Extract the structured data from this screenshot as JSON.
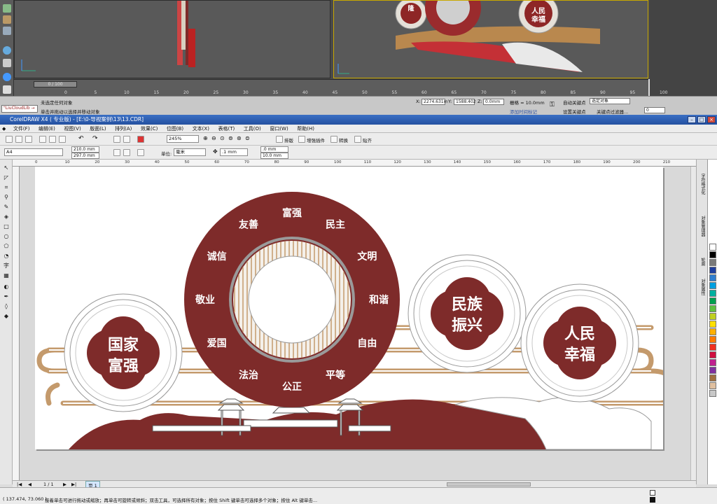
{
  "max": {
    "status_line_1": "未选定任何对象",
    "status_line_2": "单击并拖动以选择并移动对象",
    "timeline_slider": "0 / 100",
    "timeline_ticks": [
      "0",
      "5",
      "10",
      "15",
      "20",
      "25",
      "30",
      "35",
      "40",
      "45",
      "50",
      "55",
      "60",
      "65",
      "70",
      "75",
      "80",
      "85",
      "90",
      "95",
      "100"
    ],
    "coord_x_label": "X:",
    "coord_x": "2274.631m",
    "coord_y_label": "Y:",
    "coord_y": "1588.402",
    "coord_z_label": "Z:",
    "coord_z": "0.0mm",
    "grid": "栅格 = 10.0mm",
    "add_time_tag": "添加时间标记",
    "auto_key": "自动关键点",
    "set_key": "设置关键点",
    "key_filter_select": "选定对象",
    "key_filters": "关键点过滤器...",
    "frame": "0",
    "script_box": "\"LiuCloudLib →"
  },
  "corel": {
    "title": "CorelDRAW X4 ( 专业版) - [E:\\0-导视案例\\13\\13.CDR]",
    "menu": [
      "文件(F)",
      "编辑(E)",
      "视图(V)",
      "版面(L)",
      "排列(A)",
      "效果(C)",
      "位图(B)",
      "文本(X)",
      "表格(T)",
      "工具(O)",
      "窗口(W)",
      "帮助(H)"
    ],
    "toolbar": {
      "zoom": "245%",
      "typeset": "排版",
      "plugin": "增强插件",
      "convert": "转换",
      "paste": "贴齐"
    },
    "props": {
      "page_size": "A4",
      "width": "210.0 mm",
      "height": "297.0 mm",
      "unit_label": "单位:",
      "unit": "毫米",
      "nudge": ".1 mm",
      "dup_x": ".0 mm",
      "dup_y": "10.0 mm"
    },
    "ruler_ticks": [
      "0",
      "10",
      "20",
      "30",
      "40",
      "50",
      "60",
      "70",
      "80",
      "90",
      "100",
      "110",
      "120",
      "130",
      "140",
      "150",
      "160",
      "170",
      "180",
      "190",
      "200",
      "210"
    ],
    "page_nav": "1 / 1",
    "page_tab": "页 1",
    "status_coords": "( 137.474, 73.060 )",
    "status_hint": "接着单击可进行拖动或缩放；再单击可旋转或倾斜；双击工具，可选择所有对象；按住 Shift 键单击可选择多个对象；按住 Alt 键单击...",
    "dockers": [
      "字符格式化",
      "对象管理器",
      "轮廓",
      "对象属性"
    ],
    "palette": [
      "#ffffff",
      "#000000",
      "#7a7a7a",
      "#1f3f9f",
      "#2f7fd0",
      "#00a0e0",
      "#00b0a0",
      "#00a050",
      "#60c040",
      "#c0d020",
      "#ffe000",
      "#ffb000",
      "#ff7a00",
      "#f03020",
      "#d01040",
      "#c02090",
      "#8030a0",
      "#a07040",
      "#e0c0a0",
      "#c8c8c8"
    ]
  },
  "design": {
    "ring_words": [
      "富强",
      "民主",
      "文明",
      "和谐",
      "自由",
      "平等",
      "公正",
      "法治",
      "爱国",
      "敬业",
      "诚信",
      "友善"
    ],
    "left_badge": [
      "国家",
      "富强"
    ],
    "mid_badge": [
      "民族",
      "振兴"
    ],
    "right_badge": [
      "人民",
      "幸福"
    ],
    "colors": {
      "maroon": "#7e2b2a",
      "tan": "#c49a6c",
      "line": "#9a9a9a"
    }
  },
  "max_preview": {
    "badge_left": "隆",
    "badge_right": [
      "人民",
      "幸福"
    ]
  }
}
